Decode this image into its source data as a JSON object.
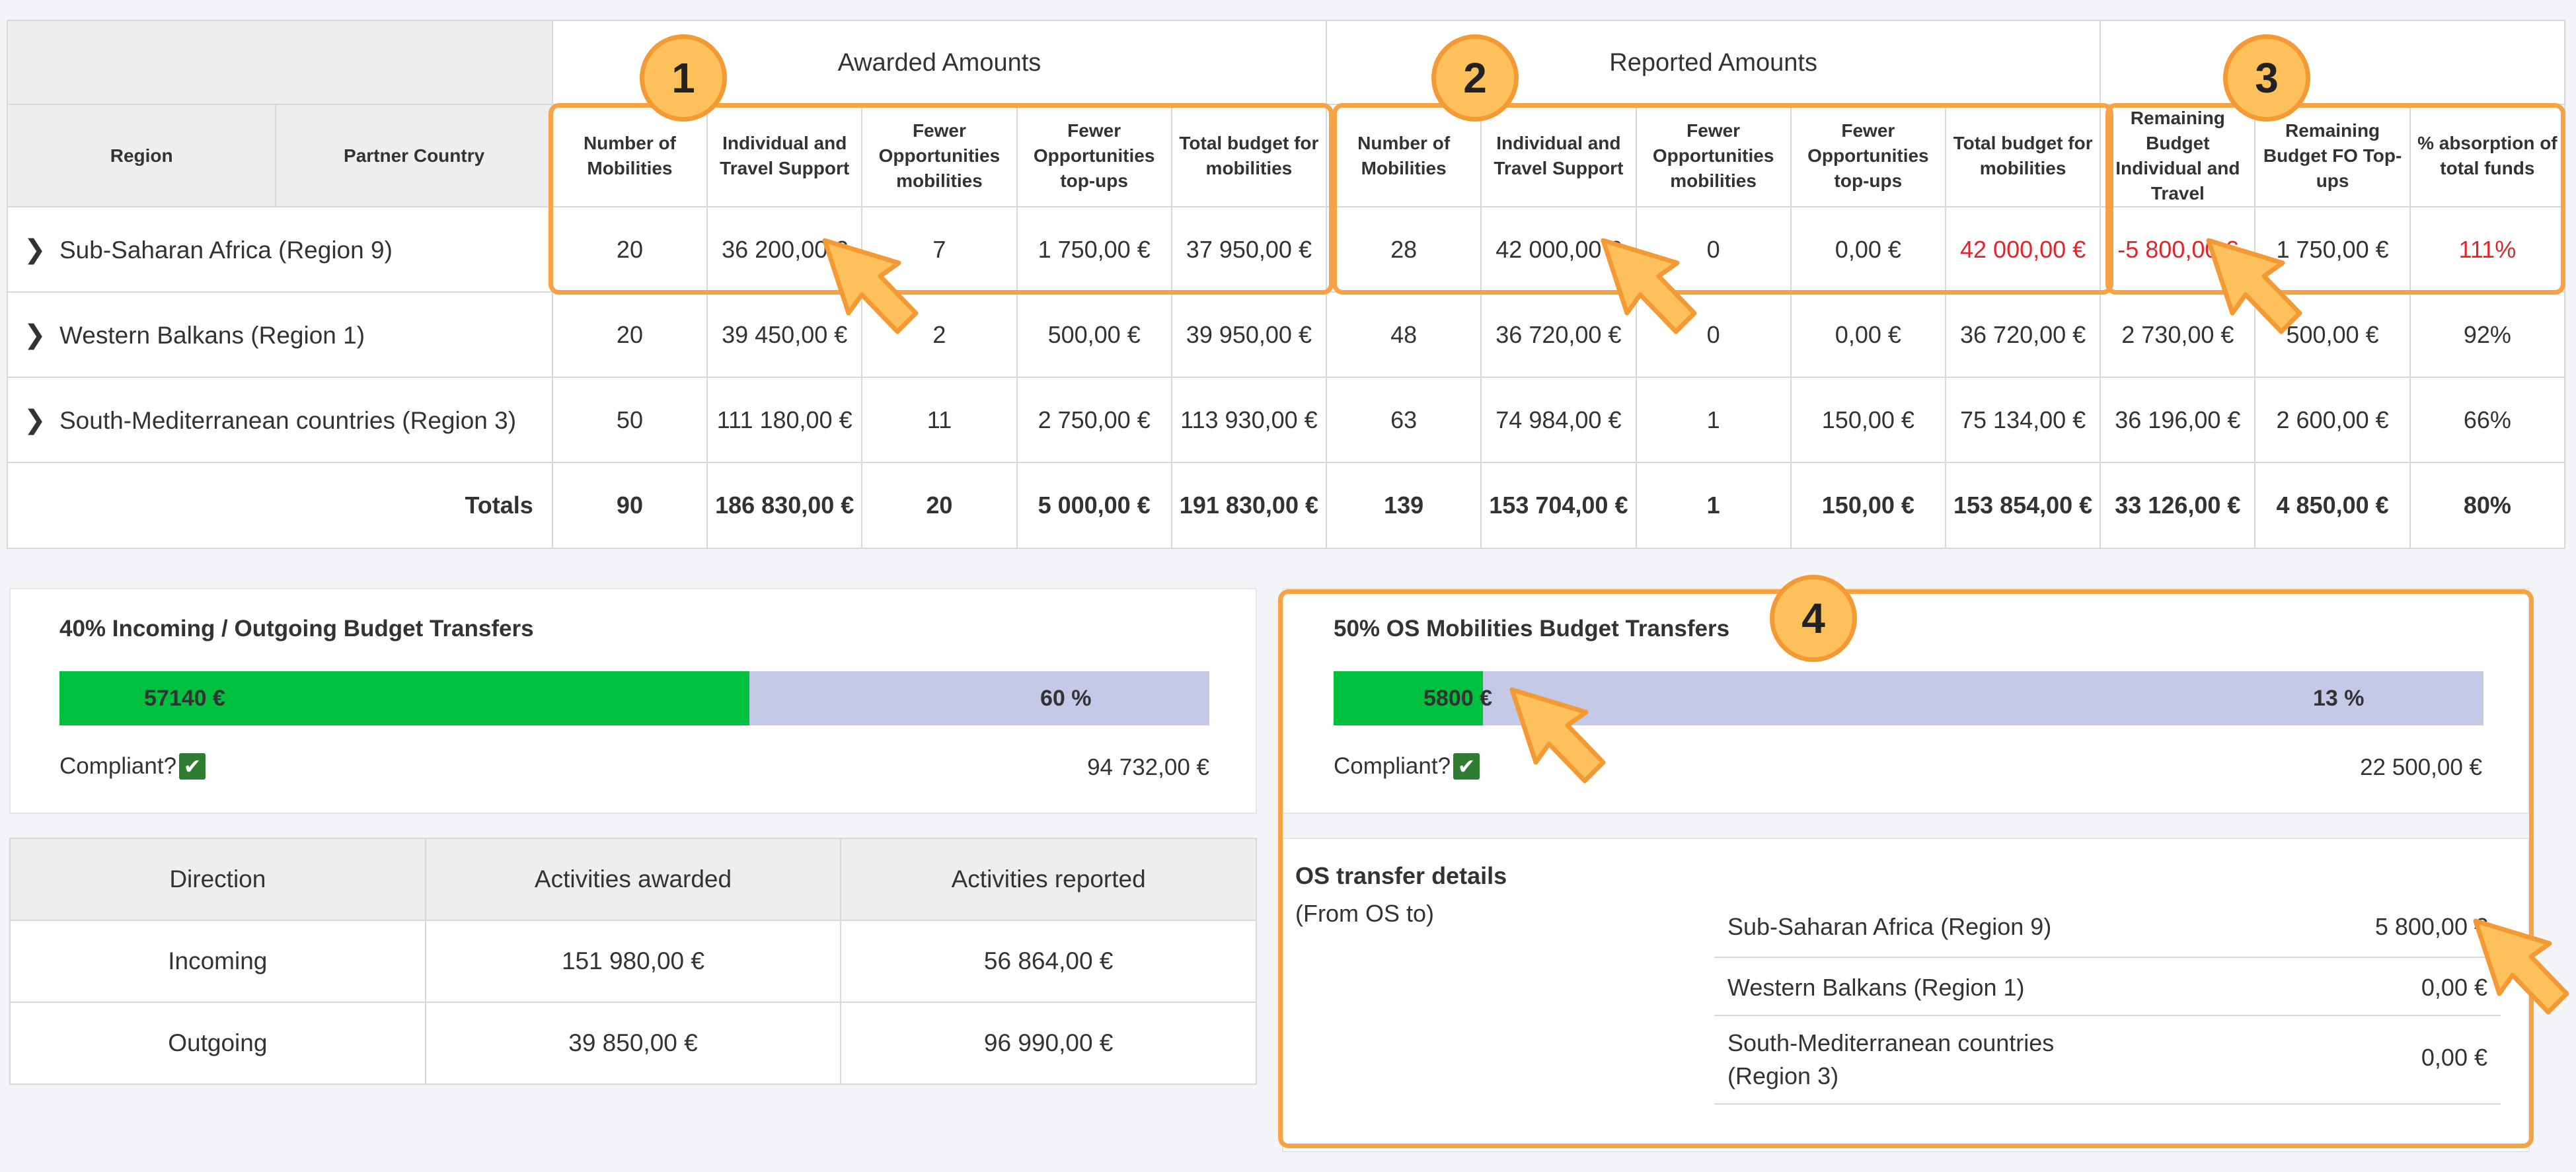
{
  "table": {
    "groups": {
      "awarded": "Awarded Amounts",
      "reported": "Reported Amounts"
    },
    "columns": {
      "region": "Region",
      "partner_country": "Partner Country",
      "aw_num": "Number of Mobilities",
      "aw_ind": "Individual and Travel Support",
      "aw_fo_mob": "Fewer Opportunities mobilities",
      "aw_fo_top": "Fewer Opportunities top-ups",
      "aw_total": "Total budget for mobilities",
      "rp_num": "Number of Mobilities",
      "rp_ind": "Individual and Travel Support",
      "rp_fo_mob": "Fewer Opportunities mobilities",
      "rp_fo_top": "Fewer Opportunities top-ups",
      "rp_total": "Total budget for mobilities",
      "rem_ind": "Remaining Budget Individual and Travel",
      "rem_fo": "Remaining Budget FO Top-ups",
      "absorption": "% absorption of total funds"
    },
    "rows": [
      {
        "region": "Sub-Saharan Africa (Region 9)",
        "aw_num": "20",
        "aw_ind": "36 200,00 €",
        "aw_fo_mob": "7",
        "aw_fo_top": "1 750,00 €",
        "aw_total": "37 950,00 €",
        "rp_num": "28",
        "rp_ind": "42 000,00 €",
        "rp_fo_mob": "0",
        "rp_fo_top": "0,00 €",
        "rp_total": "42 000,00 €",
        "rem_ind": "-5 800,00 €",
        "rem_fo": "1 750,00 €",
        "absorption": "111%"
      },
      {
        "region": "Western Balkans (Region 1)",
        "aw_num": "20",
        "aw_ind": "39 450,00 €",
        "aw_fo_mob": "2",
        "aw_fo_top": "500,00 €",
        "aw_total": "39 950,00 €",
        "rp_num": "48",
        "rp_ind": "36 720,00 €",
        "rp_fo_mob": "0",
        "rp_fo_top": "0,00 €",
        "rp_total": "36 720,00 €",
        "rem_ind": "2 730,00 €",
        "rem_fo": "500,00 €",
        "absorption": "92%"
      },
      {
        "region": "South-Mediterranean countries (Region 3)",
        "aw_num": "50",
        "aw_ind": "111 180,00 €",
        "aw_fo_mob": "11",
        "aw_fo_top": "2 750,00 €",
        "aw_total": "113 930,00 €",
        "rp_num": "63",
        "rp_ind": "74 984,00 €",
        "rp_fo_mob": "1",
        "rp_fo_top": "150,00 €",
        "rp_total": "75 134,00 €",
        "rem_ind": "36 196,00 €",
        "rem_fo": "2 600,00 €",
        "absorption": "66%"
      }
    ],
    "totals": {
      "label": "Totals",
      "aw_num": "90",
      "aw_ind": "186 830,00 €",
      "aw_fo_mob": "20",
      "aw_fo_top": "5 000,00 €",
      "aw_total": "191 830,00 €",
      "rp_num": "139",
      "rp_ind": "153 704,00 €",
      "rp_fo_mob": "1",
      "rp_fo_top": "150,00 €",
      "rp_total": "153 854,00 €",
      "rem_ind": "33 126,00 €",
      "rem_fo": "4 850,00 €",
      "absorption": "80%"
    }
  },
  "transfer40": {
    "title": "40% Incoming / Outgoing Budget Transfers",
    "fill_label": "57140 €",
    "fill_fraction": 0.6,
    "percent_label": "60 %",
    "compliant_label": "Compliant?",
    "amount": "94 732,00 €"
  },
  "transfer50": {
    "title": "50% OS Mobilities Budget Transfers",
    "fill_label": "5800 €",
    "fill_fraction": 0.13,
    "percent_label": "13 %",
    "compliant_label": "Compliant?",
    "amount": "22 500,00 €"
  },
  "directions": {
    "headers": {
      "direction": "Direction",
      "awarded": "Activities awarded",
      "reported": "Activities reported"
    },
    "rows": [
      {
        "direction": "Incoming",
        "awarded": "151 980,00 €",
        "reported": "56 864,00 €"
      },
      {
        "direction": "Outgoing",
        "awarded": "39 850,00 €",
        "reported": "96 990,00 €"
      }
    ]
  },
  "os_details": {
    "title": "OS transfer details",
    "subtitle": "(From OS to)",
    "rows": [
      {
        "name": "Sub-Saharan Africa (Region 9)",
        "value": "5 800,00 €"
      },
      {
        "name": "Western Balkans (Region 1)",
        "value": "0,00 €"
      },
      {
        "name": "South-Mediterranean countries (Region 3)",
        "value": "0,00 €"
      }
    ]
  },
  "badges": [
    "1",
    "2",
    "3",
    "4"
  ],
  "colors": {
    "accent_orange": "#f7a244",
    "bar_green": "#00c03f",
    "bar_rest": "#c4c9e8",
    "negative_red": "#e5232b"
  }
}
